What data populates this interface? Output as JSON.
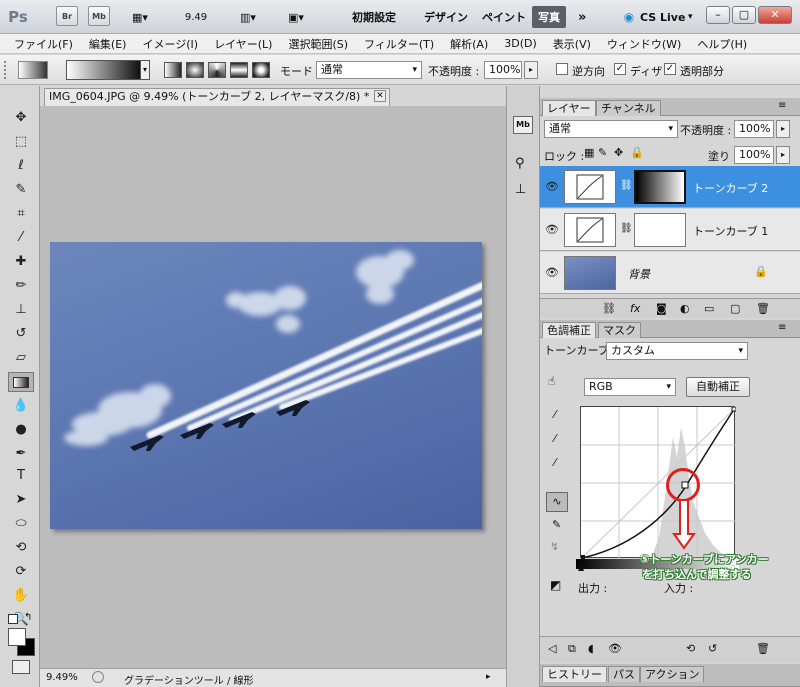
{
  "titlebar": {
    "app_icon": "Ps",
    "br": "Br",
    "mb": "Mb",
    "zoom": "9.49",
    "workspaces": [
      "初期設定",
      "デザイン",
      "ペイント",
      "写真"
    ],
    "active_workspace": "写真",
    "more": "»",
    "cslive": "CS Live"
  },
  "menu": [
    "ファイル(F)",
    "編集(E)",
    "イメージ(I)",
    "レイヤー(L)",
    "選択範囲(S)",
    "フィルター(T)",
    "解析(A)",
    "3D(D)",
    "表示(V)",
    "ウィンドウ(W)",
    "ヘルプ(H)"
  ],
  "options": {
    "mode_label": "モード :",
    "mode_value": "通常",
    "opacity_label": "不透明度 :",
    "opacity_value": "100%",
    "reverse_label": "逆方向",
    "dither_label": "ディザ",
    "transparency_label": "透明部分"
  },
  "document": {
    "tab_title": "IMG_0604.JPG @ 9.49% (トーンカーブ 2, レイヤーマスク/8) *",
    "zoom_status": "9.49%",
    "status_text": "グラデーションツール / 線形"
  },
  "layers_panel": {
    "tab_layers": "レイヤー",
    "tab_channels": "チャンネル",
    "blend_mode": "通常",
    "opacity_label": "不透明度 :",
    "opacity_value": "100%",
    "lock_label": "ロック :",
    "fill_label": "塗り :",
    "fill_value": "100%",
    "layers": [
      {
        "name": "トーンカーブ 2",
        "selected": true
      },
      {
        "name": "トーンカーブ 1",
        "selected": false
      },
      {
        "name": "背景",
        "selected": false
      }
    ]
  },
  "adjust_panel": {
    "tab_adjust": "色調補正",
    "tab_mask": "マスク",
    "title": "トーンカーブ",
    "preset": "カスタム",
    "channel": "RGB",
    "auto_button": "自動補正",
    "output_label": "出力 :",
    "input_label": "入力 :"
  },
  "annotation": {
    "line1": "⑤トーンカーブにアンカー",
    "line2": "を打ち込んで調整する"
  },
  "bottom_tabs": [
    "ヒストリー",
    "パス",
    "アクション"
  ]
}
